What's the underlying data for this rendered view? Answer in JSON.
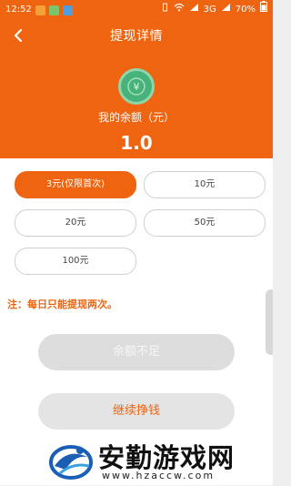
{
  "status_bar": {
    "time": "12:52",
    "network": "3G",
    "battery": "70%"
  },
  "header": {
    "title": "提现详情",
    "back_icon": "chevron-left-icon",
    "balance_label": "我的余额（元）",
    "balance_value": "1.0",
    "coin_icon": "coin-icon",
    "accent_color": "#ee6410"
  },
  "amounts": [
    {
      "label": "3元(仅限首次)",
      "selected": true
    },
    {
      "label": "10元",
      "selected": false
    },
    {
      "label": "20元",
      "selected": false
    },
    {
      "label": "50元",
      "selected": false
    },
    {
      "label": "100元",
      "selected": false
    }
  ],
  "notice": "注：每日只能提现两次。",
  "buttons": {
    "insufficient": "余额不足",
    "continue": "继续挣钱"
  },
  "watermark": {
    "title": "安勤游戏网",
    "url": "www.hzaccw.com"
  }
}
